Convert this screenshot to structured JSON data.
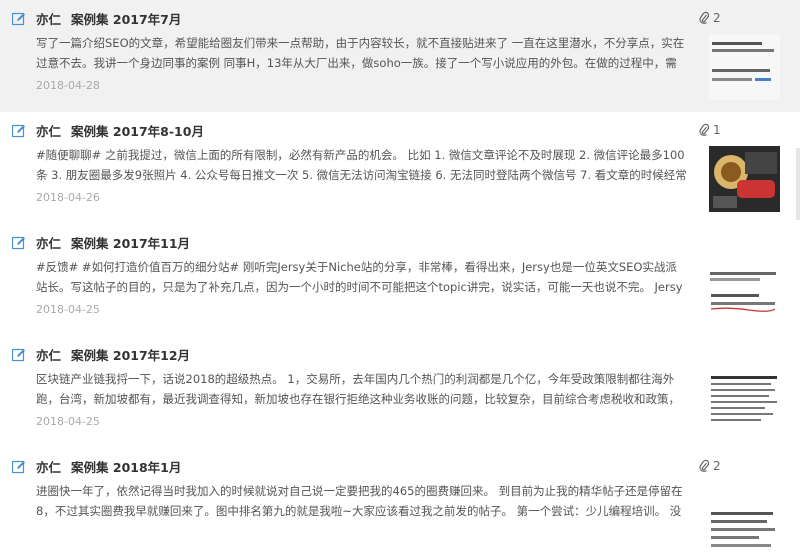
{
  "notes": [
    {
      "author": "亦仁",
      "title": "案例集 2017年7月",
      "attachments": "2",
      "snippet": "写了一篇介绍SEO的文章，希望能给圈友们带来一点帮助，由于内容较长，就不直接贴进来了 一直在这里潜水，不分享点，实在过意不去。我讲一个身边同事的案例 同事H，13年从大厂出来，做soho一族。接了一个写小说应用的外包。在做的过程中，需要到...",
      "date": "2018-04-28",
      "selected": true
    },
    {
      "author": "亦仁",
      "title": "案例集 2017年8-10月",
      "attachments": "1",
      "snippet": "#随便聊聊# 之前我提过，微信上面的所有限制，必然有新产品的机会。 比如 1. 微信文章评论不及时展现 2. 微信评论最多100条 3. 朋友圈最多发9张照片 4. 公众号每日推文一次 5. 微信无法访问淘宝链接 6. 无法同时登陆两个微信号 7. 看文章的时候经常跳出...",
      "date": "2018-04-26",
      "selected": false
    },
    {
      "author": "亦仁",
      "title": "案例集 2017年11月",
      "attachments": "",
      "snippet": "#反馈# #如何打造价值百万的细分站# 刚听完Jersy关于Niche站的分享，非常棒，看得出来，Jersy也是一位英文SEO实战派站长。写这帖子的目的，只是为了补充几点，因为一个小时的时间不可能把这个topic讲完，说实话，可能一天也说不完。 Jersy船...",
      "date": "2018-04-25",
      "selected": false
    },
    {
      "author": "亦仁",
      "title": "案例集 2017年12月",
      "attachments": "",
      "snippet": "区块链产业链我捋一下，话说2018的超级热点。 1，交易所，去年国内几个热门的利润都是几个亿，今年受政策限制都往海外跑，台湾，新加坡都有，最近我调查得知，新加坡也存在银行拒绝这种业务收账的问题，比较复杂，目前综合考虑税收和政策，几个可...",
      "date": "2018-04-25",
      "selected": false
    },
    {
      "author": "亦仁",
      "title": "案例集 2018年1月",
      "attachments": "2",
      "snippet": "进圈快一年了，依然记得当时我加入的时候就说对自己说一定要把我的465的圈费赚回来。 到目前为止我的精华帖子还是停留在8，不过其实圈费我早就赚回来了。图中排名第九的就是我啦~大家应该看过我之前发的帖子。 第一个尝试：少儿编程培训。 没想到...",
      "date": "",
      "selected": false
    }
  ],
  "colors": {
    "selected_row_bg": "#f1f1f1",
    "edit_icon": "#4a90d9",
    "date_text": "#aaaaaa"
  },
  "icons": {
    "edit": "edit-note-icon",
    "attachment": "paperclip-icon"
  }
}
